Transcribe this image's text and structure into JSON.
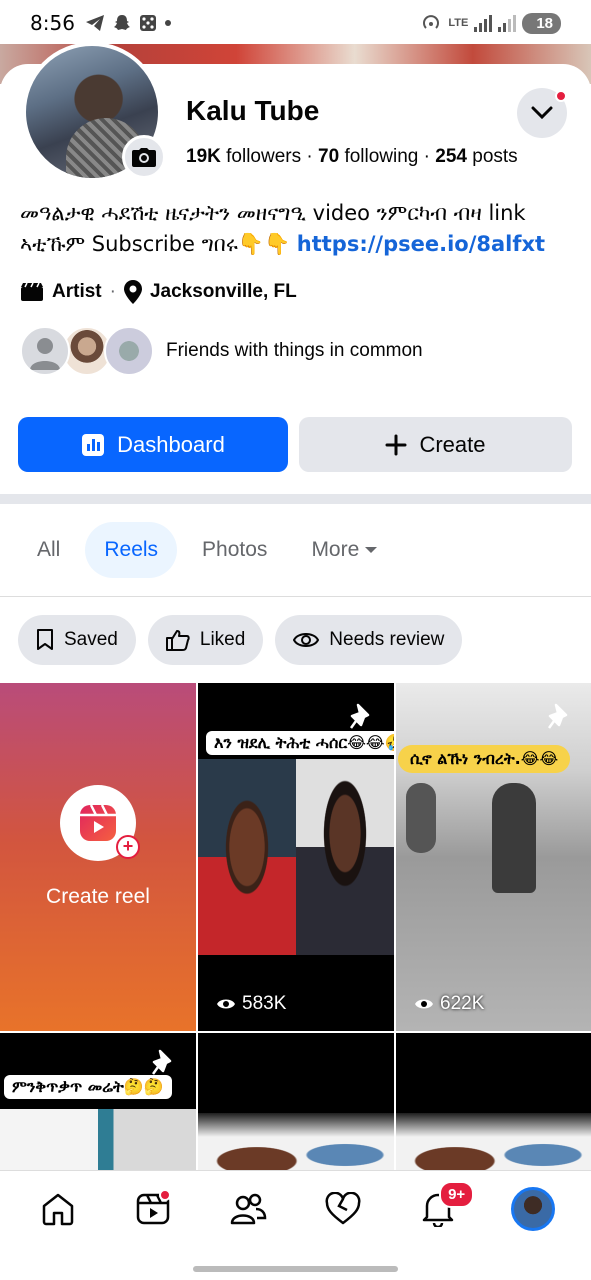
{
  "status_bar": {
    "time": "8:56",
    "network": "LTE",
    "battery": "18"
  },
  "profile": {
    "name": "Kalu Tube",
    "followers_count": "19K",
    "followers_label": "followers",
    "following_count": "70",
    "following_label": "following",
    "posts_count": "254",
    "posts_label": "posts",
    "bio_text": "መዓልታዊ ሓደሽቲ ዜናታትን መዘናግዒ video ንምርካብ ብዛ link ኣቲኹም Subscribe ግበሩ👇👇 ",
    "bio_link": "https://psee.io/8alfxt",
    "category": "Artist",
    "location": "Jacksonville, FL",
    "friends_text": "Friends with things in common"
  },
  "actions": {
    "dashboard_label": "Dashboard",
    "create_label": "Create"
  },
  "tabs": [
    {
      "label": "All"
    },
    {
      "label": "Reels",
      "active": true
    },
    {
      "label": "Photos"
    },
    {
      "label": "More"
    }
  ],
  "chips": [
    {
      "label": "Saved"
    },
    {
      "label": "Liked"
    },
    {
      "label": "Needs review"
    }
  ],
  "reels": {
    "create_label": "Create reel",
    "items": [
      {
        "caption": "እን ዝደሊ ትሕቲ ሓሰር😂😂🤣",
        "views": "583K"
      },
      {
        "caption": "ሲኖ ልኹነ ንብረት.😂😂",
        "views": "622K"
      },
      {
        "caption": "ምንቅጥቃጥ መሬት🤔🤔"
      }
    ]
  },
  "bottom_nav": {
    "notifications_badge": "9+"
  },
  "colors": {
    "accent": "#0866ff",
    "badge": "#e41e3f",
    "chip_bg": "#e4e6eb"
  }
}
